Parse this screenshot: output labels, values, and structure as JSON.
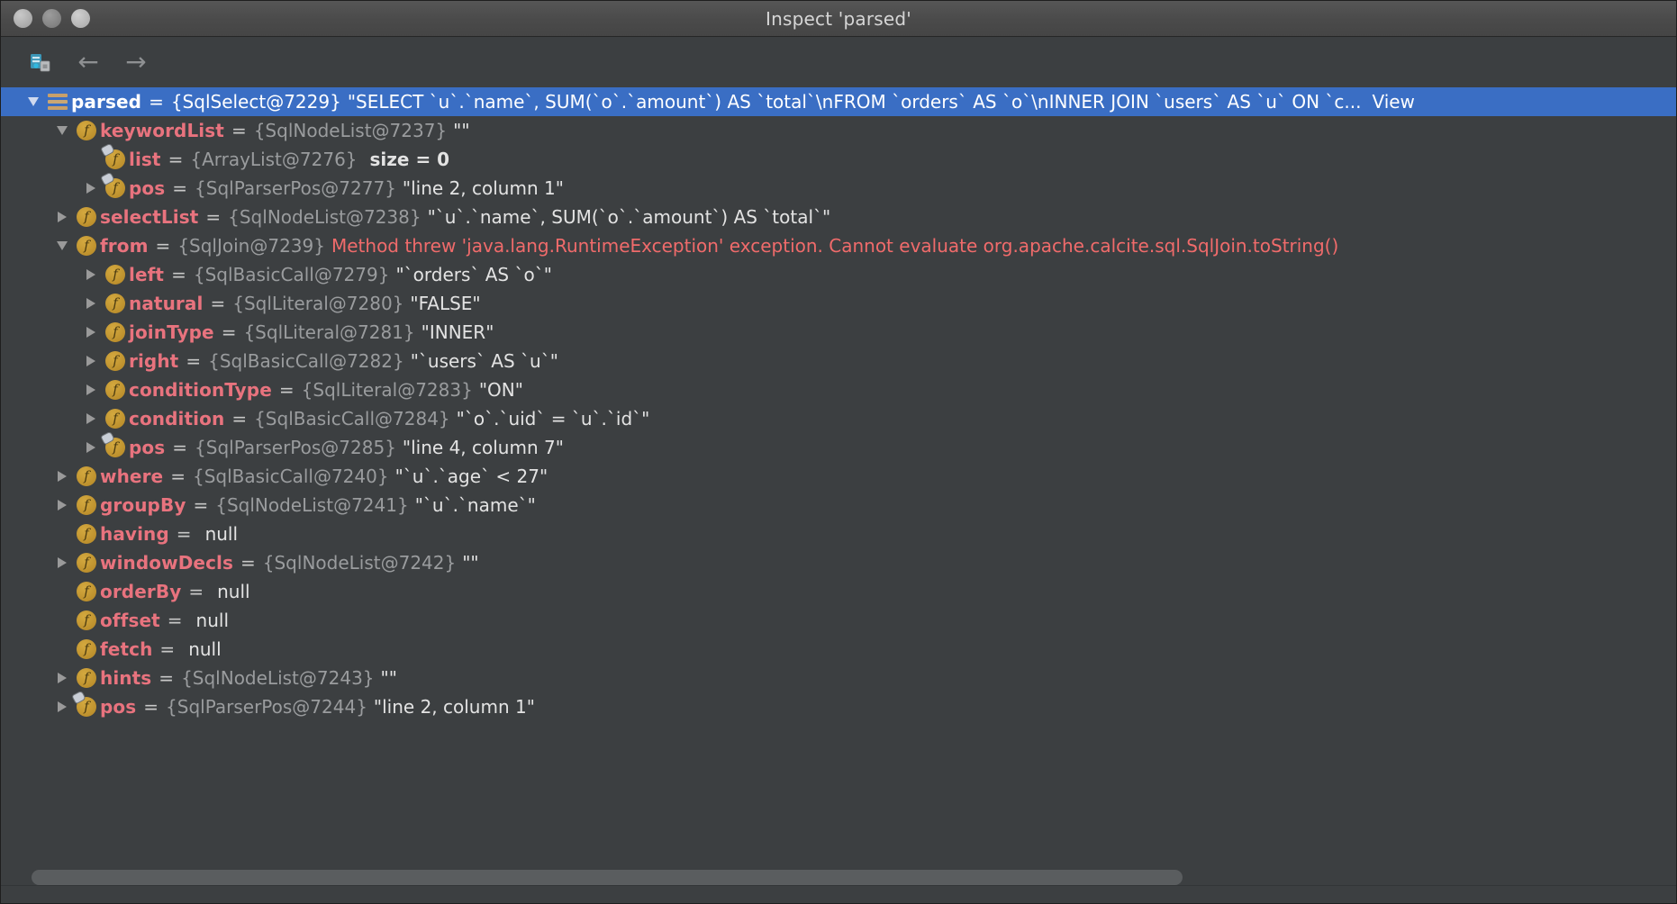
{
  "window": {
    "title": "Inspect 'parsed'",
    "traffic_lights": [
      "close",
      "minimize",
      "zoom"
    ]
  },
  "toolbar": {
    "items": [
      {
        "name": "show-as-object-tree-icon",
        "glyph": ""
      },
      {
        "name": "back-arrow-icon",
        "glyph": "←"
      },
      {
        "name": "forward-arrow-icon",
        "glyph": "→"
      }
    ]
  },
  "colors": {
    "background": "#3c3f41",
    "selection": "#3a6ec4",
    "field_name": "#e8737e",
    "type_info": "#9a9c9e",
    "value": "#e3e3e3",
    "error": "#f06b6b",
    "field_icon": "#bc8f2c"
  },
  "tree": {
    "rows": [
      {
        "depth": 0,
        "twisty": "expanded",
        "icon": "object-node-icon",
        "selected": true,
        "name": "parsed",
        "eq": "=",
        "type": "{SqlSelect@7229}",
        "value": "\"SELECT `u`.`name`, SUM(`o`.`amount`) AS `total`\\nFROM `orders` AS `o`\\nINNER JOIN `users` AS `u` ON `c...",
        "link": "View"
      },
      {
        "depth": 1,
        "twisty": "expanded",
        "icon": "field-icon",
        "name": "keywordList",
        "eq": "=",
        "type": "{SqlNodeList@7237}",
        "value": "\"\""
      },
      {
        "depth": 2,
        "twisty": "none",
        "icon": "field-final-icon",
        "name": "list",
        "eq": "=",
        "type": "{ArrayList@7276}",
        "size": "size = 0"
      },
      {
        "depth": 2,
        "twisty": "collapsed",
        "icon": "field-final-icon",
        "name": "pos",
        "eq": "=",
        "type": "{SqlParserPos@7277}",
        "value": "\"line 2, column 1\""
      },
      {
        "depth": 1,
        "twisty": "collapsed",
        "icon": "field-icon",
        "name": "selectList",
        "eq": "=",
        "type": "{SqlNodeList@7238}",
        "value": "\"`u`.`name`, SUM(`o`.`amount`) AS `total`\""
      },
      {
        "depth": 1,
        "twisty": "expanded",
        "icon": "field-icon",
        "name": "from",
        "eq": "=",
        "type": "{SqlJoin@7239}",
        "error": "Method threw 'java.lang.RuntimeException' exception. Cannot evaluate org.apache.calcite.sql.SqlJoin.toString()"
      },
      {
        "depth": 2,
        "twisty": "collapsed",
        "icon": "field-icon",
        "name": "left",
        "eq": "=",
        "type": "{SqlBasicCall@7279}",
        "value": "\"`orders` AS `o`\""
      },
      {
        "depth": 2,
        "twisty": "collapsed",
        "icon": "field-icon",
        "name": "natural",
        "eq": "=",
        "type": "{SqlLiteral@7280}",
        "value": "\"FALSE\""
      },
      {
        "depth": 2,
        "twisty": "collapsed",
        "icon": "field-icon",
        "name": "joinType",
        "eq": "=",
        "type": "{SqlLiteral@7281}",
        "value": "\"INNER\""
      },
      {
        "depth": 2,
        "twisty": "collapsed",
        "icon": "field-icon",
        "name": "right",
        "eq": "=",
        "type": "{SqlBasicCall@7282}",
        "value": "\"`users` AS `u`\""
      },
      {
        "depth": 2,
        "twisty": "collapsed",
        "icon": "field-icon",
        "name": "conditionType",
        "eq": "=",
        "type": "{SqlLiteral@7283}",
        "value": "\"ON\""
      },
      {
        "depth": 2,
        "twisty": "collapsed",
        "icon": "field-icon",
        "name": "condition",
        "eq": "=",
        "type": "{SqlBasicCall@7284}",
        "value": "\"`o`.`uid` = `u`.`id`\""
      },
      {
        "depth": 2,
        "twisty": "collapsed",
        "icon": "field-final-icon",
        "name": "pos",
        "eq": "=",
        "type": "{SqlParserPos@7285}",
        "value": "\"line 4, column 7\""
      },
      {
        "depth": 1,
        "twisty": "collapsed",
        "icon": "field-icon",
        "name": "where",
        "eq": "=",
        "type": "{SqlBasicCall@7240}",
        "value": "\"`u`.`age` < 27\""
      },
      {
        "depth": 1,
        "twisty": "collapsed",
        "icon": "field-icon",
        "name": "groupBy",
        "eq": "=",
        "type": "{SqlNodeList@7241}",
        "value": "\"`u`.`name`\""
      },
      {
        "depth": 1,
        "twisty": "none",
        "icon": "field-icon",
        "name": "having",
        "eq": "=",
        "nullvalue": "null"
      },
      {
        "depth": 1,
        "twisty": "collapsed",
        "icon": "field-icon",
        "name": "windowDecls",
        "eq": "=",
        "type": "{SqlNodeList@7242}",
        "value": "\"\""
      },
      {
        "depth": 1,
        "twisty": "none",
        "icon": "field-icon",
        "name": "orderBy",
        "eq": "=",
        "nullvalue": "null"
      },
      {
        "depth": 1,
        "twisty": "none",
        "icon": "field-icon",
        "name": "offset",
        "eq": "=",
        "nullvalue": "null"
      },
      {
        "depth": 1,
        "twisty": "none",
        "icon": "field-icon",
        "name": "fetch",
        "eq": "=",
        "nullvalue": "null"
      },
      {
        "depth": 1,
        "twisty": "collapsed",
        "icon": "field-icon",
        "name": "hints",
        "eq": "=",
        "type": "{SqlNodeList@7243}",
        "value": "\"\""
      },
      {
        "depth": 1,
        "twisty": "collapsed",
        "icon": "field-final-icon",
        "name": "pos",
        "eq": "=",
        "type": "{SqlParserPos@7244}",
        "value": "\"line 2, column 1\""
      }
    ]
  }
}
